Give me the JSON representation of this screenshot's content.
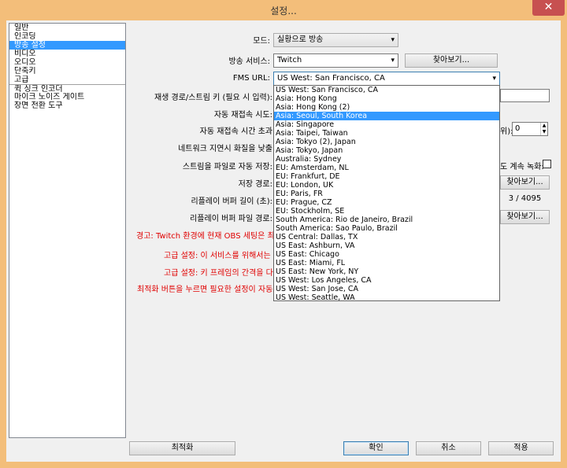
{
  "window": {
    "title": "설정...",
    "close": "✕"
  },
  "sidebar": {
    "items": [
      "일반",
      "인코딩",
      "방송 설정",
      "비디오",
      "오디오",
      "단축키",
      "고급",
      "퀵 싱크 인코더",
      "마이크 노이즈 게이트",
      "장면 전환 도구"
    ],
    "selected_index": 2
  },
  "form": {
    "mode_label": "모드:",
    "mode_value": "실황으로 방송",
    "service_label": "방송 서비스:",
    "service_value": "Twitch",
    "browse_label": "찾아보기...",
    "fms_label": "FMS URL:",
    "fms_value": "US West: San Francisco, CA",
    "stream_key_label": "재생 경로/스트림 키 (필요 시 입력):",
    "auto_reconnect_label": "자동 재접속 시도:",
    "auto_reconnect_timeout_label": "자동 재접속 시간 초과",
    "timeout_suffix": "위):",
    "timeout_value": "0",
    "network_delay_label": "네트워크 지연시 화질을 낮출",
    "save_to_file_label": "스트림을 파일로 자동 저장:",
    "keep_record_label": "도 계속 녹화:",
    "save_path_label": "저장 경로:",
    "replay_buffer_label": "리플레이 버퍼 길이 (초):",
    "replay_buffer_value": "3 / 4095",
    "replay_path_label": "리플레이 버퍼 파일 경로:"
  },
  "warnings": [
    "경고: Twitch 환경에 현재 OBS 세팅은 최적",
    "고급 설정: 이 서비스를 위해서는 '",
    "고급 설정: 키 프레임의 간격을 다",
    "최적화 버튼을 누르면 필요한 설정이 자동으"
  ],
  "dropdown": {
    "selected_index": 3,
    "options": [
      "US West: San Francisco, CA",
      "Asia: Hong Kong",
      "Asia: Hong Kong (2)",
      "Asia: Seoul, South Korea",
      "Asia: Singapore",
      "Asia: Taipei, Taiwan",
      "Asia: Tokyo (2), Japan",
      "Asia: Tokyo, Japan",
      "Australia: Sydney",
      "EU: Amsterdam, NL",
      "EU: Frankfurt, DE",
      "EU: London, UK",
      "EU: Paris, FR",
      "EU: Prague, CZ",
      "EU: Stockholm, SE",
      "South America: Rio de Janeiro, Brazil",
      "South America: Sao Paulo, Brazil",
      "US Central: Dallas, TX",
      "US East: Ashburn, VA",
      "US East: Chicago",
      "US East: Miami, FL",
      "US East: New York, NY",
      "US West: Los Angeles, CA",
      "US West: San Jose, CA",
      "US West: Seattle, WA"
    ]
  },
  "buttons": {
    "optimize": "최적화",
    "ok": "확인",
    "cancel": "취소",
    "apply": "적용"
  },
  "colors": {
    "selection": "#3399ff",
    "warning": "#e00000",
    "frame": "#f3be7a"
  }
}
